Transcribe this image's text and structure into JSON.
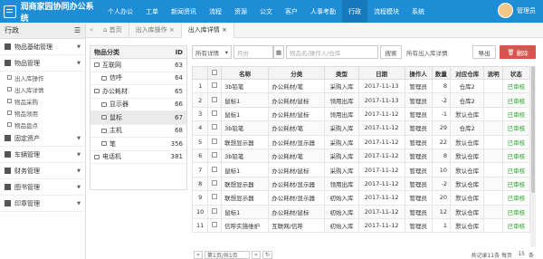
{
  "app": {
    "title": "润商家园协同办公系统",
    "user": "管理员"
  },
  "nav": [
    "个人办公",
    "工单",
    "新闻资讯",
    "流程",
    "资源",
    "公文",
    "客户",
    "人事考勤",
    "行政",
    "流程模块",
    "系统"
  ],
  "sidebar": {
    "header": "行政",
    "items": [
      {
        "label": "物品基础管理",
        "type": "item"
      },
      {
        "label": "物品管理",
        "type": "item"
      },
      {
        "label": "出入库操作",
        "type": "sub"
      },
      {
        "label": "出入库详情",
        "type": "sub"
      },
      {
        "label": "物品采购",
        "type": "sub"
      },
      {
        "label": "物品领用",
        "type": "sub"
      },
      {
        "label": "物品盘点",
        "type": "sub"
      },
      {
        "label": "固定资产",
        "type": "item"
      },
      {
        "label": "车辆管理",
        "type": "item"
      },
      {
        "label": "财务管理",
        "type": "item"
      },
      {
        "label": "图书管理",
        "type": "item"
      },
      {
        "label": "印章管理",
        "type": "item"
      }
    ]
  },
  "tabs": [
    "首页",
    "出入库操作",
    "出入库详情"
  ],
  "tree": {
    "header": {
      "name": "物品分类",
      "id": "ID"
    },
    "rows": [
      {
        "name": "互联网",
        "id": "63",
        "level": 0
      },
      {
        "name": "信呼",
        "id": "64",
        "level": 1
      },
      {
        "name": "办公耗材",
        "id": "65",
        "level": 0
      },
      {
        "name": "显示器",
        "id": "66",
        "level": 1
      },
      {
        "name": "鼠标",
        "id": "67",
        "level": 1
      },
      {
        "name": "主机",
        "id": "68",
        "level": 1
      },
      {
        "name": "笔",
        "id": "356",
        "level": 1
      },
      {
        "name": "电话机",
        "id": "381",
        "level": 0
      }
    ]
  },
  "toolbar": {
    "filter": "所有详情",
    "date_placeholder": "月份",
    "search_placeholder": "物品名/操作人/仓库",
    "search_btn": "搜索",
    "select": "所有出入库详情",
    "export": "导出",
    "delete": "删除"
  },
  "table": {
    "headers": [
      "",
      "",
      "名称",
      "分类",
      "类型",
      "日期",
      "操作人",
      "数量",
      "对应仓库",
      "说明",
      "状态"
    ],
    "rows": [
      [
        "1",
        "3b铅笔",
        "办公耗材/笔",
        "采购入库",
        "2017-11-13",
        "管理员",
        "8",
        "仓库2",
        "",
        "已审核"
      ],
      [
        "2",
        "鼠标1",
        "办公耗材/鼠标",
        "领用出库",
        "2017-11-13",
        "管理员",
        "-2",
        "仓库2",
        "",
        "已审核"
      ],
      [
        "3",
        "鼠标1",
        "办公耗材/鼠标",
        "领用出库",
        "2017-11-12",
        "管理员",
        "-1",
        "默认仓库",
        "",
        "已审核"
      ],
      [
        "4",
        "3b铅笔",
        "办公耗材/笔",
        "采购入库",
        "2017-11-12",
        "管理员",
        "29",
        "仓库2",
        "",
        "已审核"
      ],
      [
        "5",
        "联想显示器",
        "办公耗材/显示器",
        "采购入库",
        "2017-11-12",
        "管理员",
        "22",
        "默认仓库",
        "",
        "已审核"
      ],
      [
        "6",
        "3b铅笔",
        "办公耗材/笔",
        "采购入库",
        "2017-11-12",
        "管理员",
        "8",
        "默认仓库",
        "",
        "已审核"
      ],
      [
        "7",
        "鼠标1",
        "办公耗材/鼠标",
        "采购入库",
        "2017-11-12",
        "管理员",
        "10",
        "默认仓库",
        "",
        "已审核"
      ],
      [
        "8",
        "联想显示器",
        "办公耗材/显示器",
        "领用出库",
        "2017-11-12",
        "管理员",
        "-2",
        "默认仓库",
        "",
        "已审核"
      ],
      [
        "9",
        "联想显示器",
        "办公耗材/显示器",
        "初始入库",
        "2017-11-12",
        "管理员",
        "20",
        "默认仓库",
        "",
        "已审核"
      ],
      [
        "10",
        "鼠标1",
        "办公耗材/鼠标",
        "初始入库",
        "2017-11-12",
        "管理员",
        "12",
        "默认仓库",
        "",
        "已审核"
      ],
      [
        "11",
        "信呼实施维护",
        "互联网/信呼",
        "初始入库",
        "2017-11-12",
        "管理员",
        "1",
        "默认仓库",
        "",
        "已审核"
      ]
    ]
  },
  "pager": {
    "page": "第1页/共1页",
    "summary": "共记录11条 每页",
    "per": "15",
    "unit": "条"
  }
}
